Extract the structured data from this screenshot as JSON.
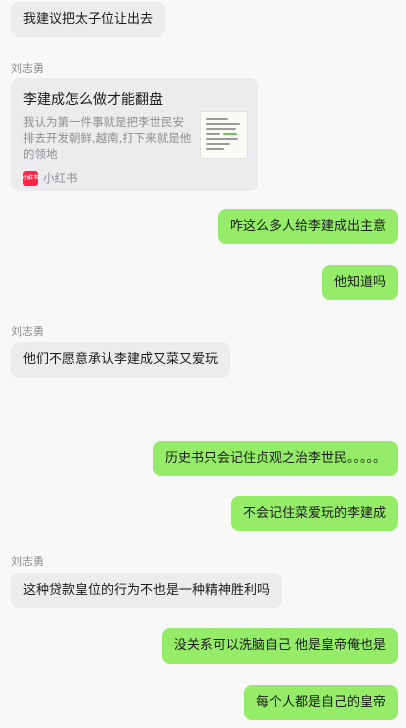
{
  "messages": {
    "m1": "我建议把太子位让出去",
    "sender1": "刘志勇",
    "card": {
      "title": "李建成怎么做才能翻盘",
      "description": "我认为第一件事就是把李世民安排去开发朝鲜,越南,打下来就是他的领地",
      "source": "小红书",
      "source_logo_text": "小红书"
    },
    "m2": "咋这么多人给李建成出主意",
    "m3": "他知道吗",
    "sender2": "刘志勇",
    "m4": "他们不愿意承认李建成又菜又爱玩",
    "m5": "历史书只会记住贞观之治李世民。。。。。",
    "m6": "不会记住菜爱玩的李建成",
    "sender3": "刘志勇",
    "m7": "这种贷款皇位的行为不也是一种精神胜利吗",
    "m8": "没关系可以洗脑自己 他是皇帝俺也是",
    "m9": "每个人都是自己的皇帝"
  },
  "colors": {
    "incoming_bubble": "#ececee",
    "outgoing_bubble": "#95ec69",
    "background": "#f8f8f8",
    "xiaohongshu_red": "#ff2442"
  }
}
